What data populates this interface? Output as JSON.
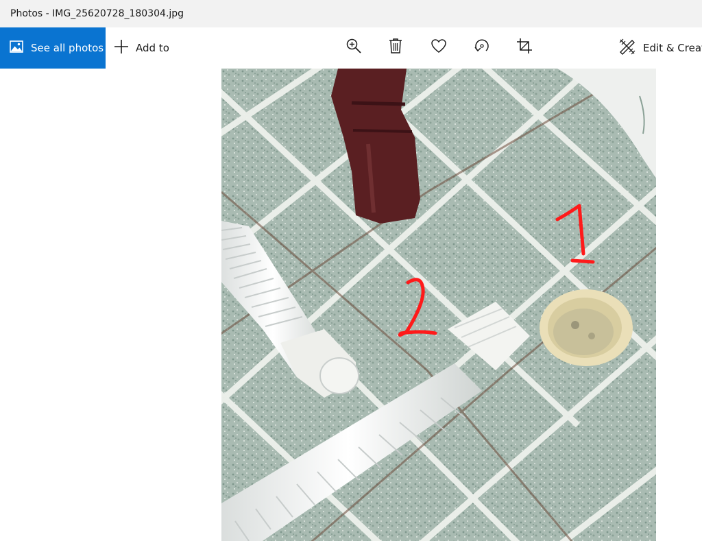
{
  "window": {
    "title": "Photos - IMG_25620728_180304.jpg"
  },
  "toolbar": {
    "see_all_label": "See all photos",
    "add_to_label": "Add to",
    "edit_create_label": "Edit & Create",
    "icons": [
      "photo-icon",
      "plus-icon",
      "zoom-in-icon",
      "delete-icon",
      "favorite-icon",
      "rotate-icon",
      "crop-icon",
      "edit-create-icon"
    ]
  },
  "photo": {
    "annotations": [
      "1",
      "2"
    ],
    "annotation_color": "#ff1a1a"
  },
  "colors": {
    "accent": "#0a74d1",
    "titlebar": "#f2f2f2"
  }
}
